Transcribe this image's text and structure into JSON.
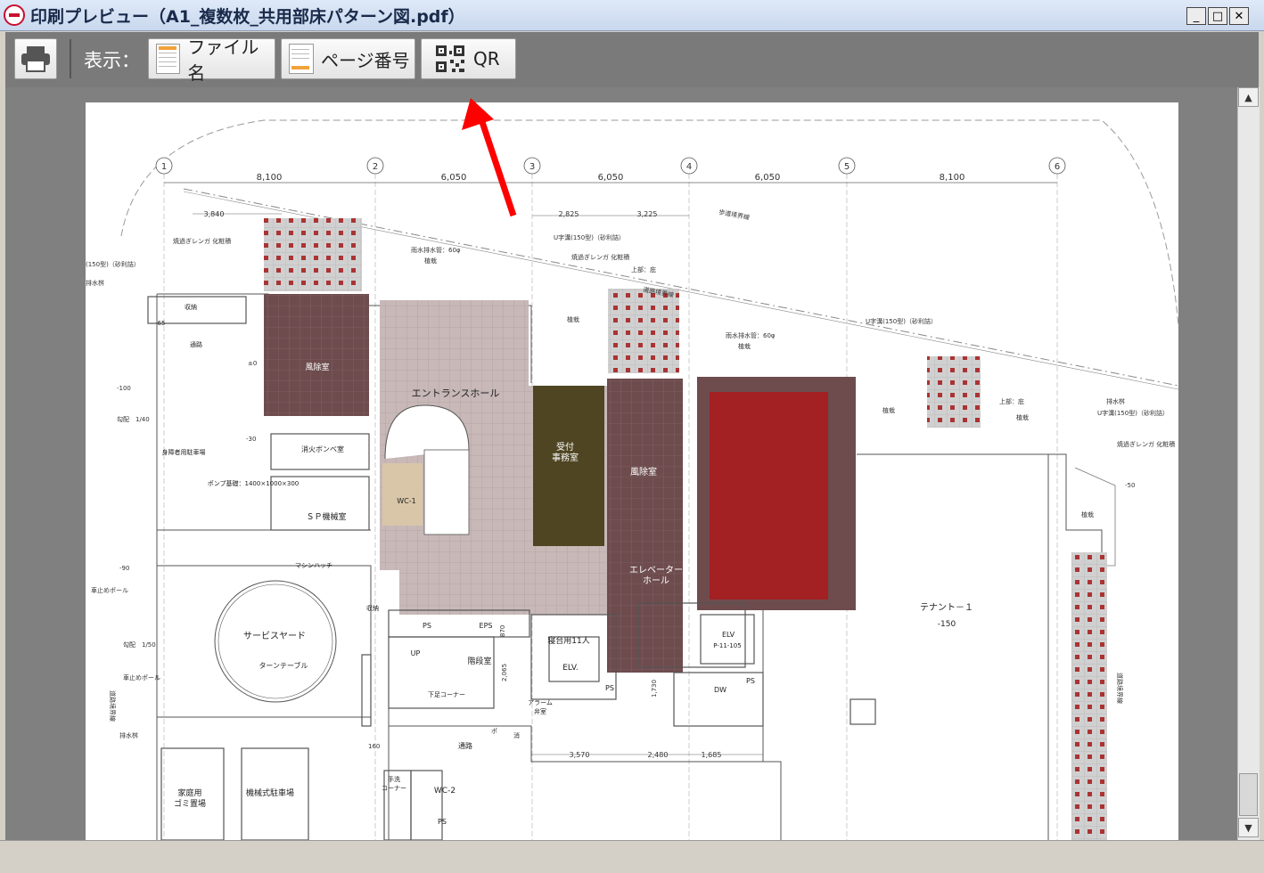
{
  "window": {
    "title": "印刷プレビュー（A1_複数枚_共用部床パターン図.pdf）",
    "minimize": "_",
    "maximize": "□",
    "close": "✕"
  },
  "toolbar": {
    "display_label": "表示：",
    "filename_button": "ファイル名",
    "page_number_button": "ページ番号",
    "qr_button": "QR"
  },
  "scrollbar": {
    "up": "▲",
    "down": "▼",
    "position": 0.94
  },
  "colors": {
    "toolbar_bg": "#7a7a7a",
    "dark_brown_room": "#6e4c4e",
    "olive_room": "#4f4522",
    "red_room": "#a32023",
    "beige_room": "#d9c6a8",
    "pinkgray_floor": "#c6b5b5",
    "annotation_arrow": "#ff0000"
  },
  "drawing": {
    "grid_axes": [
      "1",
      "2",
      "3",
      "4",
      "5",
      "6"
    ],
    "spans": [
      "8,100",
      "6,050",
      "6,050",
      "6,050",
      "8,100"
    ],
    "dims_small": [
      "3,840",
      "2,825",
      "3,225",
      "3,570",
      "2,480",
      "1,685"
    ],
    "rooms": {
      "wind_room_1": "風除室",
      "entrance_hall": "エントランスホール",
      "reception": "受付\n事務室",
      "wind_room_2": "風除室",
      "elevator_hall": "エレベーター\nホール",
      "tenant": "テナント－１",
      "tenant_level": "-150",
      "service_yard": "サービスヤード",
      "turntable": "ターンテーブル",
      "sp_room": "ＳＰ機械室",
      "gas_cylinder": "消火ボンベ室",
      "wc1": "WC-1",
      "wc2": "WC-2",
      "stair": "階段室",
      "elv": "ELV.",
      "elv2": "ELV",
      "elv2_code": "P-11-105",
      "stretcher": "寝台用11人",
      "passage": "通路",
      "passage2": "通路",
      "shoe": "下足コーナー",
      "garbage": "家庭用\nゴミ置場",
      "parking": "機械式駐車場",
      "disabled_parking": "身障者用駐車場",
      "storage": "収納",
      "storage2": "収納",
      "manhole": "マシンハッチ",
      "pump": "ポンプ基礎：1400×1000×300",
      "alarm": "アラーム\n弁室",
      "hand_wash": "手洗\nコーナー",
      "ps1": "PS",
      "ps2": "PS",
      "ps3": "PS",
      "ps4": "PS",
      "eps": "EPS",
      "dw": "DW",
      "up": "UP"
    },
    "notes": {
      "sidewalk_line": "歩道境界線",
      "road_line": "道路境界線",
      "road_line_v": "道路境界線",
      "road_line_v2": "道路境界線",
      "rain_pipe1": "雨水排水管：60φ",
      "rain_pipe2": "雨水排水管：60φ",
      "planting1": "植栽",
      "planting2": "植栽",
      "planting3": "植栽",
      "planting4": "植栽",
      "planting5": "植栽",
      "planting6": "植栽",
      "u_gutter1": "U字溝(150型)（砂利詰）",
      "u_gutter2": "U字溝(150型)（砂利詰）",
      "u_gutter3": "U字溝(150型)（砂利詰）",
      "u_gutter4": "(150型)（砂利詰）",
      "burned_brick1": "焼過ぎレンガ 化粧積",
      "burned_brick2": "焼過ぎレンガ 化粧積",
      "burned_brick3": "焼過ぎレンガ 化粧積",
      "top_soil": "上部：庇",
      "top_soil2": "上部：庇",
      "drain": "排水桝",
      "drain2": "排水桝",
      "drain3": "排水桝",
      "car_stop1": "車止めポール",
      "car_stop2": "車止めポール",
      "slope1": "勾配　1/40",
      "slope2": "勾配　1/50",
      "lv_m65": "-65",
      "lv_m100": "-100",
      "lv_m30": "-30",
      "lv_m90": "-90",
      "lv_m50": "-50",
      "lv_0": "±0",
      "lv_870": "870",
      "lv_2065": "2,065",
      "lv_1730": "1,730",
      "lv_160": "160",
      "hydrant": "消",
      "pole": "ポ"
    }
  }
}
